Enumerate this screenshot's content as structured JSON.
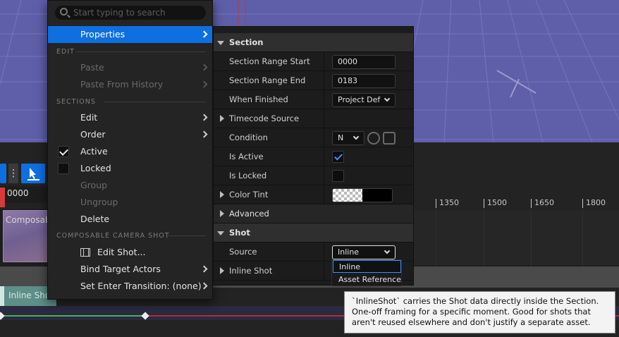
{
  "context_menu": {
    "search_placeholder": "Start typing to search",
    "items": {
      "properties": "Properties",
      "edit_header": "EDIT",
      "paste": "Paste",
      "paste_history": "Paste From History",
      "sections_header": "SECTIONS",
      "edit": "Edit",
      "order": "Order",
      "active": "Active",
      "locked": "Locked",
      "group": "Group",
      "ungroup": "Ungroup",
      "delete": "Delete",
      "composable_header": "COMPOSABLE CAMERA SHOT",
      "edit_shot": "Edit Shot...",
      "bind_target": "Bind Target Actors",
      "set_enter": "Set Enter Transition: (none)"
    },
    "active_checked": true,
    "locked_checked": false
  },
  "properties_panel": {
    "section_category": "Section",
    "section_range_start_label": "Section Range Start",
    "section_range_start_value": "0000",
    "section_range_end_label": "Section Range End",
    "section_range_end_value": "0183",
    "when_finished_label": "When Finished",
    "when_finished_value": "Project Def",
    "timecode_source_label": "Timecode Source",
    "condition_label": "Condition",
    "condition_value": "N",
    "is_active_label": "Is Active",
    "is_active_checked": true,
    "is_locked_label": "Is Locked",
    "is_locked_checked": false,
    "color_tint_label": "Color Tint",
    "advanced_label": "Advanced",
    "shot_category": "Shot",
    "source_label": "Source",
    "source_value": "Inline",
    "inline_shot_label": "Inline Shot"
  },
  "source_dropdown_options": [
    "Inline",
    "Asset Reference"
  ],
  "tooltip": {
    "text": "`InlineShot` carries the Shot data directly inside the Section. One-off framing for a specific moment. Good for shots that aren't reused elsewhere and don't justify a separate asset."
  },
  "sequencer": {
    "current_time": "0000",
    "ruler_ticks": [
      "1350",
      "1500",
      "1650",
      "1800"
    ],
    "clip_labels": {
      "composable": "Composab",
      "inline_shot": "Inline Shot"
    }
  },
  "colors": {
    "accent": "#0e6fe0",
    "viewport_bg": "#5e5ea9",
    "clip_teal": "#5e8f88"
  }
}
